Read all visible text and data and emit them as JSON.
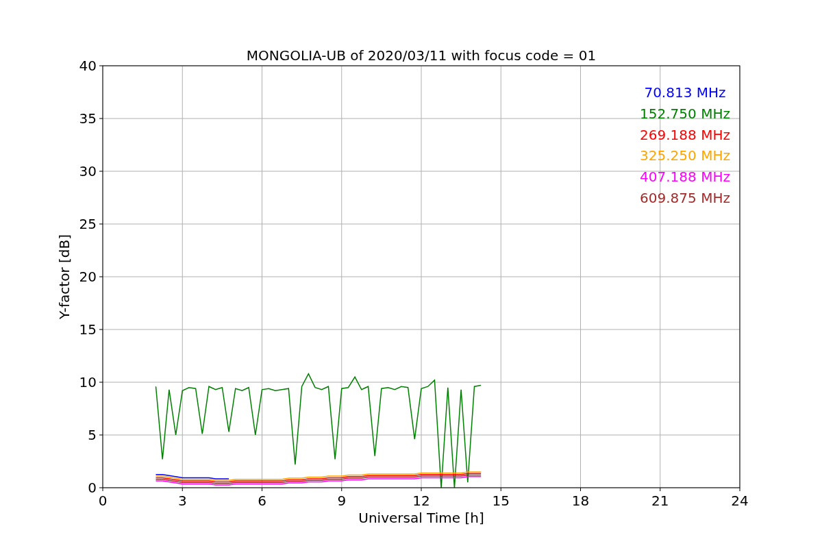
{
  "figure": {
    "chart_data": {
      "type": "line",
      "title": "MONGOLIA-UB of 2020/03/11 with focus code = 01",
      "xlabel": "Universal Time [h]",
      "ylabel": "Y-factor [dB]",
      "grid": true,
      "xlim": [
        0,
        24
      ],
      "ylim": [
        0,
        40
      ],
      "xticks": [
        0,
        3,
        6,
        9,
        12,
        15,
        18,
        21,
        24
      ],
      "yticks": [
        0,
        5,
        10,
        15,
        20,
        25,
        30,
        35,
        40
      ],
      "x": [
        2,
        2.25,
        2.5,
        2.75,
        3,
        3.25,
        3.5,
        3.75,
        4,
        4.25,
        4.5,
        4.75,
        5,
        5.25,
        5.5,
        5.75,
        6,
        6.25,
        6.5,
        6.75,
        7,
        7.25,
        7.5,
        7.75,
        8,
        8.25,
        8.5,
        8.75,
        9,
        9.25,
        9.5,
        9.75,
        10,
        10.25,
        10.5,
        10.75,
        11,
        11.25,
        11.5,
        11.75,
        12,
        12.25,
        12.5,
        12.75,
        13,
        13.25,
        13.5,
        13.75,
        14,
        14.25
      ],
      "series": [
        {
          "name": "70.813 MHz",
          "color": "#0000ff",
          "values": [
            1.25,
            1.25,
            1.15,
            1.05,
            0.95,
            0.95,
            0.95,
            0.95,
            0.95,
            0.85,
            0.85,
            0.85,
            null,
            null,
            null,
            null,
            null,
            null,
            null,
            null,
            null,
            null,
            null,
            null,
            null,
            null,
            null,
            null,
            null,
            null,
            null,
            null,
            null,
            null,
            null,
            null,
            null,
            null,
            null,
            null,
            null,
            null,
            null,
            null,
            null,
            null,
            null,
            null,
            null,
            null
          ]
        },
        {
          "name": "152.750 MHz",
          "color": "#008000",
          "values": [
            9.6,
            2.7,
            9.3,
            5.0,
            9.2,
            9.5,
            9.4,
            5.1,
            9.6,
            9.3,
            9.5,
            5.3,
            9.4,
            9.2,
            9.5,
            5.0,
            9.3,
            9.4,
            9.2,
            9.3,
            9.4,
            2.2,
            9.6,
            10.8,
            9.5,
            9.3,
            9.6,
            2.7,
            9.4,
            9.5,
            10.5,
            9.3,
            9.6,
            3.0,
            9.4,
            9.5,
            9.3,
            9.6,
            9.5,
            4.6,
            9.4,
            9.6,
            10.2,
            0,
            9.5,
            0,
            9.3,
            0.5,
            9.6,
            9.7
          ]
        },
        {
          "name": "269.188 MHz",
          "color": "#ff0000",
          "values": [
            0.95,
            0.95,
            0.85,
            0.75,
            0.65,
            0.65,
            0.65,
            0.65,
            0.65,
            0.55,
            0.55,
            0.55,
            0.65,
            0.65,
            0.65,
            0.65,
            0.65,
            0.65,
            0.65,
            0.65,
            0.75,
            0.75,
            0.75,
            0.85,
            0.85,
            0.85,
            0.95,
            0.95,
            0.95,
            1.05,
            1.05,
            1.05,
            1.15,
            1.15,
            1.15,
            1.15,
            1.15,
            1.15,
            1.15,
            1.15,
            1.25,
            1.25,
            1.25,
            1.25,
            1.25,
            1.25,
            1.25,
            1.35,
            1.35,
            1.35
          ]
        },
        {
          "name": "325.250 MHz",
          "color": "#ffa500",
          "values": [
            1.1,
            1.1,
            1.0,
            0.9,
            0.8,
            0.8,
            0.8,
            0.8,
            0.8,
            0.7,
            0.7,
            0.7,
            0.8,
            0.8,
            0.8,
            0.8,
            0.8,
            0.8,
            0.8,
            0.8,
            0.9,
            0.9,
            0.9,
            1.0,
            1.0,
            1.0,
            1.1,
            1.1,
            1.1,
            1.2,
            1.2,
            1.2,
            1.3,
            1.3,
            1.3,
            1.3,
            1.3,
            1.3,
            1.3,
            1.3,
            1.4,
            1.4,
            1.4,
            1.4,
            1.4,
            1.4,
            1.4,
            1.5,
            1.5,
            1.5
          ]
        },
        {
          "name": "407.188 MHz",
          "color": "#ff00ff",
          "values": [
            0.65,
            0.65,
            0.55,
            0.45,
            0.35,
            0.35,
            0.35,
            0.35,
            0.35,
            0.25,
            0.25,
            0.25,
            0.35,
            0.35,
            0.35,
            0.35,
            0.35,
            0.35,
            0.35,
            0.35,
            0.45,
            0.45,
            0.45,
            0.55,
            0.55,
            0.55,
            0.65,
            0.65,
            0.65,
            0.75,
            0.75,
            0.75,
            0.85,
            0.85,
            0.85,
            0.85,
            0.85,
            0.85,
            0.85,
            0.85,
            0.95,
            0.95,
            0.95,
            0.95,
            0.95,
            0.95,
            0.95,
            1.05,
            1.05,
            1.05
          ]
        },
        {
          "name": "609.875 MHz",
          "color": "#a52a2a",
          "values": [
            0.8,
            0.8,
            0.7,
            0.6,
            0.5,
            0.5,
            0.5,
            0.5,
            0.5,
            0.4,
            0.4,
            0.4,
            0.5,
            0.5,
            0.5,
            0.5,
            0.5,
            0.5,
            0.5,
            0.5,
            0.6,
            0.6,
            0.6,
            0.7,
            0.7,
            0.7,
            0.8,
            0.8,
            0.8,
            0.9,
            0.9,
            0.9,
            1.0,
            1.0,
            1.0,
            1.0,
            1.0,
            1.0,
            1.0,
            1.0,
            1.1,
            1.1,
            1.1,
            1.1,
            1.1,
            1.1,
            1.1,
            1.2,
            1.2,
            1.2
          ]
        }
      ]
    }
  }
}
